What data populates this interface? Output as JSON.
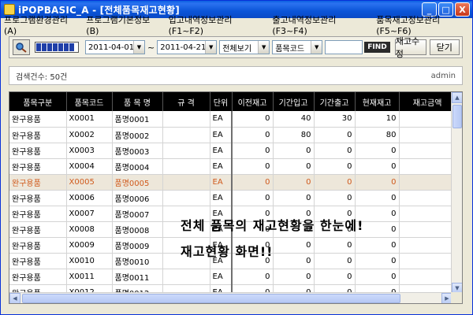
{
  "window": {
    "title": "iPOPBASIC_A - [전체품목재고현황]",
    "minimize": "_",
    "maximize": "□",
    "close": "X"
  },
  "menu": [
    "프로그램환경관리(A)",
    "프로그램기본정보(B)",
    "입고내역정보관리(F1~F2)",
    "출고내역정보관리(F3~F4)",
    "품목재고정보관리(F5~F6)"
  ],
  "toolbar": {
    "date_from": "2011-04-01",
    "tilde": "~",
    "date_to": "2011-04-21",
    "view_mode": "전체보기",
    "search_field": "품목코드",
    "search_value": "",
    "find_label": "FIND",
    "edit_stock_label": "재고수정",
    "close_label": "닫기",
    "colors": {
      "progress": "#1f3fa7"
    }
  },
  "info": {
    "count_text": "검색건수: 50건",
    "user": "admin"
  },
  "grid": {
    "headers": [
      "품목구분",
      "품목코드",
      "품 목 명",
      "규   격",
      "단위",
      "이전재고",
      "기간입고",
      "기간출고",
      "현재재고",
      "재고금액"
    ],
    "selected_color": "#d05a1c",
    "rows": [
      [
        "완구용품",
        "X0001",
        "품명0001",
        "",
        "EA",
        "0",
        "40",
        "30",
        "10",
        ""
      ],
      [
        "완구용품",
        "X0002",
        "품명0002",
        "",
        "EA",
        "0",
        "80",
        "0",
        "80",
        ""
      ],
      [
        "완구용품",
        "X0003",
        "품명0003",
        "",
        "EA",
        "0",
        "0",
        "0",
        "0",
        ""
      ],
      [
        "완구용품",
        "X0004",
        "품명0004",
        "",
        "EA",
        "0",
        "0",
        "0",
        "0",
        ""
      ],
      [
        "완구용품",
        "X0005",
        "품명0005",
        "",
        "EA",
        "0",
        "0",
        "0",
        "0",
        ""
      ],
      [
        "완구용품",
        "X0006",
        "품명0006",
        "",
        "EA",
        "0",
        "0",
        "0",
        "0",
        ""
      ],
      [
        "완구용품",
        "X0007",
        "품명0007",
        "",
        "EA",
        "0",
        "0",
        "0",
        "0",
        ""
      ],
      [
        "완구용품",
        "X0008",
        "품명0008",
        "",
        "EA",
        "0",
        "0",
        "0",
        "0",
        ""
      ],
      [
        "완구용품",
        "X0009",
        "품명0009",
        "",
        "EA",
        "0",
        "0",
        "0",
        "0",
        ""
      ],
      [
        "완구용품",
        "X0010",
        "품명0010",
        "",
        "EA",
        "0",
        "0",
        "0",
        "0",
        ""
      ],
      [
        "완구용품",
        "X0011",
        "품명0011",
        "",
        "EA",
        "0",
        "0",
        "0",
        "0",
        ""
      ],
      [
        "완구용품",
        "X0012",
        "품명0012",
        "",
        "EA",
        "0",
        "0",
        "0",
        "0",
        ""
      ]
    ],
    "selected_row_index": 4
  },
  "caption": {
    "line1": "전체 품목의 재고현황을 한눈에!",
    "line2": "재고현황 화면!!"
  }
}
